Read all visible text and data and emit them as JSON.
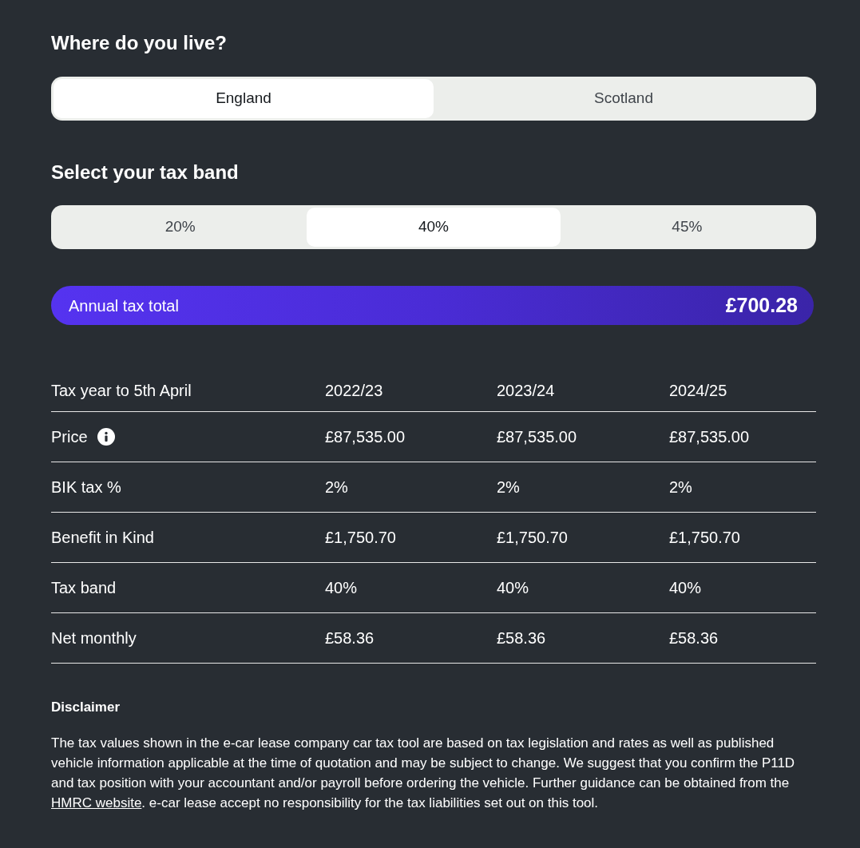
{
  "location": {
    "title": "Where do you live?",
    "options": [
      {
        "label": "England",
        "selected": true
      },
      {
        "label": "Scotland",
        "selected": false
      }
    ]
  },
  "tax_band": {
    "title": "Select your tax band",
    "options": [
      {
        "label": "20%",
        "selected": false
      },
      {
        "label": "40%",
        "selected": true
      },
      {
        "label": "45%",
        "selected": false
      }
    ]
  },
  "annual_total": {
    "label": "Annual tax total",
    "value": "£700.28"
  },
  "table": {
    "columns": [
      "Tax year to 5th April",
      "2022/23",
      "2023/24",
      "2024/25"
    ],
    "rows": [
      {
        "info_icon": true,
        "cells": [
          "Price",
          "£87,535.00",
          "£87,535.00",
          "£87,535.00"
        ]
      },
      {
        "info_icon": false,
        "cells": [
          "BIK tax %",
          "2%",
          "2%",
          "2%"
        ]
      },
      {
        "info_icon": false,
        "cells": [
          "Benefit in Kind",
          "£1,750.70",
          "£1,750.70",
          "£1,750.70"
        ]
      },
      {
        "info_icon": false,
        "cells": [
          "Tax band",
          "40%",
          "40%",
          "40%"
        ]
      },
      {
        "info_icon": false,
        "cells": [
          "Net monthly",
          "£58.36",
          "£58.36",
          "£58.36"
        ]
      }
    ]
  },
  "disclaimer": {
    "title": "Disclaimer",
    "text_before": "The tax values shown in the e-car lease company car tax tool are based on tax legislation and rates as well as published vehicle information applicable at the time of quotation and may be subject to change. We suggest that you confirm the P11D and tax position with your accountant and/or payroll before ordering the vehicle. Further guidance can be obtained from the ",
    "link": "HMRC website",
    "text_after": ". e-car lease accept no responsibility for the tax liabilities set out on this tool."
  }
}
